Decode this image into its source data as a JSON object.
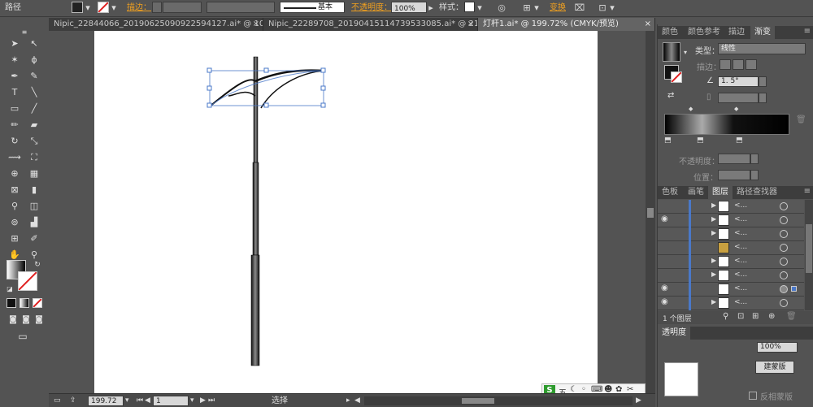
{
  "control_bar": {
    "object_type": "路径",
    "stroke_label": "描边：",
    "stroke_style_label": "基本",
    "opacity_label": "不透明度：",
    "opacity_value": "100%",
    "style_label": "样式：",
    "transform_label": "变换"
  },
  "tabs": [
    {
      "label": "Nipic_22844066_20190625090922594127.ai* @ 10...",
      "close": "×"
    },
    {
      "label": "Nipic_22289708_20190415114739533085.ai* @ 21...",
      "close": "×"
    },
    {
      "label": "灯杆1.ai* @ 199.72% (CMYK/预览)",
      "close": "×"
    }
  ],
  "tools_header": "≡",
  "status_bar": {
    "zoom": "199.72",
    "page": "1",
    "tool_label": "选择"
  },
  "panels": {
    "top_tabs": [
      "颜色",
      "颜色参考",
      "描边",
      "渐变"
    ],
    "gradient": {
      "type_label": "类型：",
      "type_value": "线性",
      "stroke_label": "描边：",
      "angle_value": "1. 5°",
      "opacity_label": "不透明度：",
      "position_label": "位置："
    },
    "layer_tabs": [
      "色板",
      "画笔",
      "图层",
      "路径查找器"
    ],
    "layers": [
      {
        "name": "<...",
        "eye": ""
      },
      {
        "name": "<...",
        "eye": "◉"
      },
      {
        "name": "<...",
        "eye": ""
      },
      {
        "name": "<...",
        "eye": ""
      },
      {
        "name": "<...",
        "eye": ""
      },
      {
        "name": "<...",
        "eye": ""
      },
      {
        "name": "<...",
        "eye": "◉"
      },
      {
        "name": "<...",
        "eye": "◉"
      }
    ],
    "layer_count": "1 个图层",
    "transparency_tab": "透明度",
    "transparency_value": "100%",
    "mask_button": "建蒙版",
    "invert_mask": "反相蒙版"
  },
  "ime_bar": {
    "brand": "S",
    "mode": "五"
  },
  "colors": {
    "ui_bg": "#535353",
    "accent_orange": "#f0a020",
    "selection_blue": "#4a78c8"
  }
}
